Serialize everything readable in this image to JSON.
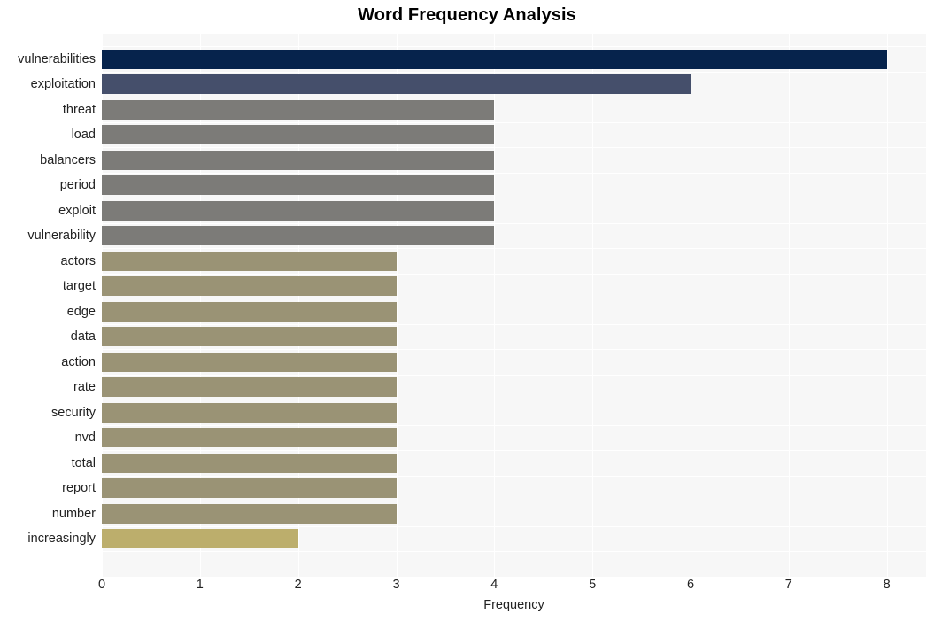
{
  "chart_data": {
    "type": "bar",
    "orientation": "horizontal",
    "title": "Word Frequency Analysis",
    "xlabel": "Frequency",
    "ylabel": "",
    "xlim": [
      0,
      8.4
    ],
    "xticks": [
      0,
      1,
      2,
      3,
      4,
      5,
      6,
      7,
      8
    ],
    "xtick_labels": [
      "0",
      "1",
      "2",
      "3",
      "4",
      "5",
      "6",
      "7",
      "8"
    ],
    "grid": true,
    "legend": "none",
    "plot_background": "#f7f7f7",
    "gridline_color": "#ffffff",
    "categories": [
      "vulnerabilities",
      "exploitation",
      "threat",
      "load",
      "balancers",
      "period",
      "exploit",
      "vulnerability",
      "actors",
      "target",
      "edge",
      "data",
      "action",
      "rate",
      "security",
      "nvd",
      "total",
      "report",
      "number",
      "increasingly"
    ],
    "values": [
      8,
      6,
      4,
      4,
      4,
      4,
      4,
      4,
      3,
      3,
      3,
      3,
      3,
      3,
      3,
      3,
      3,
      3,
      3,
      2
    ],
    "bar_colors": [
      "#06234c",
      "#454f6b",
      "#7c7b78",
      "#7c7b78",
      "#7c7b78",
      "#7c7b78",
      "#7c7b78",
      "#7c7b78",
      "#9a9375",
      "#9a9375",
      "#9a9375",
      "#9a9375",
      "#9a9375",
      "#9a9375",
      "#9a9375",
      "#9a9375",
      "#9a9375",
      "#9a9375",
      "#9a9375",
      "#bcae6c"
    ]
  }
}
